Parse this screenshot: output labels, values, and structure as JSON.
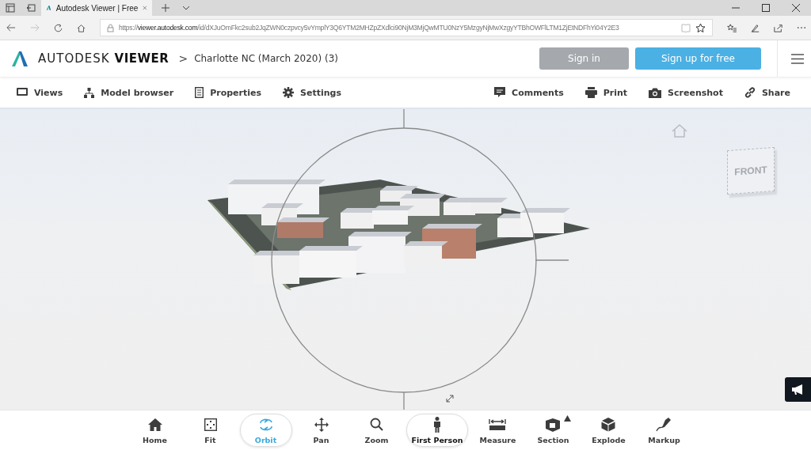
{
  "browser": {
    "tab_title": "Autodesk Viewer | Free",
    "url_scheme": "https://",
    "url_host": "viewer.autodesk.com",
    "url_path": "/id/dXJuOmFkc2sub2JqZWN0czpvcy5vYmplY3Q6YTM2MHZpZXdlci90NjM3MjQwMTU0NzY5MzgyNjMwXzgyYTBhOWFlLTM1ZjEtNDFhYi04Y2E3"
  },
  "header": {
    "brand": "AUTODESK",
    "product": "VIEWER",
    "breadcrumb_separator": ">",
    "document": "Charlotte NC (March 2020) (3)",
    "sign_in": "Sign in",
    "sign_up": "Sign up for free"
  },
  "toolbar_left": [
    {
      "label": "Views",
      "kind": "views"
    },
    {
      "label": "Model browser",
      "kind": "tree"
    },
    {
      "label": "Properties",
      "kind": "properties"
    },
    {
      "label": "Settings",
      "kind": "settings"
    }
  ],
  "toolbar_right": [
    {
      "label": "Comments",
      "kind": "comments"
    },
    {
      "label": "Print",
      "kind": "print"
    },
    {
      "label": "Screenshot",
      "kind": "camera"
    },
    {
      "label": "Share",
      "kind": "link"
    }
  ],
  "viewcube": {
    "face": "FRONT"
  },
  "tools": [
    {
      "label": "Home",
      "kind": "home",
      "selected": false,
      "outlined": false,
      "flyout": false
    },
    {
      "label": "Fit",
      "kind": "fit",
      "selected": false,
      "outlined": false,
      "flyout": false
    },
    {
      "label": "Orbit",
      "kind": "orbit",
      "selected": true,
      "outlined": true,
      "flyout": false
    },
    {
      "label": "Pan",
      "kind": "pan",
      "selected": false,
      "outlined": false,
      "flyout": false
    },
    {
      "label": "Zoom",
      "kind": "zoom",
      "selected": false,
      "outlined": false,
      "flyout": false
    },
    {
      "label": "First Person",
      "kind": "person",
      "selected": false,
      "outlined": true,
      "flyout": false
    },
    {
      "label": "Measure",
      "kind": "measure",
      "selected": false,
      "outlined": false,
      "flyout": false
    },
    {
      "label": "Section",
      "kind": "section",
      "selected": false,
      "outlined": false,
      "flyout": true
    },
    {
      "label": "Explode",
      "kind": "explode",
      "selected": false,
      "outlined": false,
      "flyout": false
    },
    {
      "label": "Markup",
      "kind": "markup",
      "selected": false,
      "outlined": false,
      "flyout": false
    }
  ]
}
